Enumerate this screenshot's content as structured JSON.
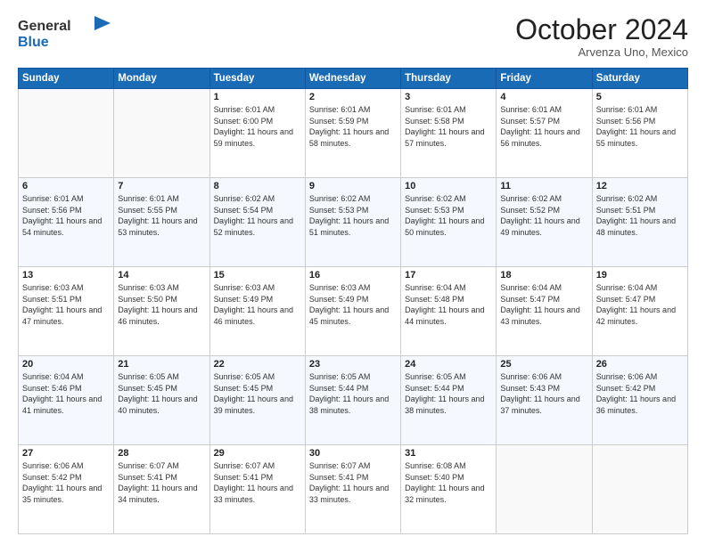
{
  "header": {
    "logo_line1": "General",
    "logo_line2": "Blue",
    "month": "October 2024",
    "location": "Arvenza Uno, Mexico"
  },
  "days_of_week": [
    "Sunday",
    "Monday",
    "Tuesday",
    "Wednesday",
    "Thursday",
    "Friday",
    "Saturday"
  ],
  "weeks": [
    [
      {
        "day": "",
        "info": ""
      },
      {
        "day": "",
        "info": ""
      },
      {
        "day": "1",
        "sunrise": "6:01 AM",
        "sunset": "6:00 PM",
        "daylight": "11 hours and 59 minutes."
      },
      {
        "day": "2",
        "sunrise": "6:01 AM",
        "sunset": "5:59 PM",
        "daylight": "11 hours and 58 minutes."
      },
      {
        "day": "3",
        "sunrise": "6:01 AM",
        "sunset": "5:58 PM",
        "daylight": "11 hours and 57 minutes."
      },
      {
        "day": "4",
        "sunrise": "6:01 AM",
        "sunset": "5:57 PM",
        "daylight": "11 hours and 56 minutes."
      },
      {
        "day": "5",
        "sunrise": "6:01 AM",
        "sunset": "5:56 PM",
        "daylight": "11 hours and 55 minutes."
      }
    ],
    [
      {
        "day": "6",
        "sunrise": "6:01 AM",
        "sunset": "5:56 PM",
        "daylight": "11 hours and 54 minutes."
      },
      {
        "day": "7",
        "sunrise": "6:01 AM",
        "sunset": "5:55 PM",
        "daylight": "11 hours and 53 minutes."
      },
      {
        "day": "8",
        "sunrise": "6:02 AM",
        "sunset": "5:54 PM",
        "daylight": "11 hours and 52 minutes."
      },
      {
        "day": "9",
        "sunrise": "6:02 AM",
        "sunset": "5:53 PM",
        "daylight": "11 hours and 51 minutes."
      },
      {
        "day": "10",
        "sunrise": "6:02 AM",
        "sunset": "5:53 PM",
        "daylight": "11 hours and 50 minutes."
      },
      {
        "day": "11",
        "sunrise": "6:02 AM",
        "sunset": "5:52 PM",
        "daylight": "11 hours and 49 minutes."
      },
      {
        "day": "12",
        "sunrise": "6:02 AM",
        "sunset": "5:51 PM",
        "daylight": "11 hours and 48 minutes."
      }
    ],
    [
      {
        "day": "13",
        "sunrise": "6:03 AM",
        "sunset": "5:51 PM",
        "daylight": "11 hours and 47 minutes."
      },
      {
        "day": "14",
        "sunrise": "6:03 AM",
        "sunset": "5:50 PM",
        "daylight": "11 hours and 46 minutes."
      },
      {
        "day": "15",
        "sunrise": "6:03 AM",
        "sunset": "5:49 PM",
        "daylight": "11 hours and 46 minutes."
      },
      {
        "day": "16",
        "sunrise": "6:03 AM",
        "sunset": "5:49 PM",
        "daylight": "11 hours and 45 minutes."
      },
      {
        "day": "17",
        "sunrise": "6:04 AM",
        "sunset": "5:48 PM",
        "daylight": "11 hours and 44 minutes."
      },
      {
        "day": "18",
        "sunrise": "6:04 AM",
        "sunset": "5:47 PM",
        "daylight": "11 hours and 43 minutes."
      },
      {
        "day": "19",
        "sunrise": "6:04 AM",
        "sunset": "5:47 PM",
        "daylight": "11 hours and 42 minutes."
      }
    ],
    [
      {
        "day": "20",
        "sunrise": "6:04 AM",
        "sunset": "5:46 PM",
        "daylight": "11 hours and 41 minutes."
      },
      {
        "day": "21",
        "sunrise": "6:05 AM",
        "sunset": "5:45 PM",
        "daylight": "11 hours and 40 minutes."
      },
      {
        "day": "22",
        "sunrise": "6:05 AM",
        "sunset": "5:45 PM",
        "daylight": "11 hours and 39 minutes."
      },
      {
        "day": "23",
        "sunrise": "6:05 AM",
        "sunset": "5:44 PM",
        "daylight": "11 hours and 38 minutes."
      },
      {
        "day": "24",
        "sunrise": "6:05 AM",
        "sunset": "5:44 PM",
        "daylight": "11 hours and 38 minutes."
      },
      {
        "day": "25",
        "sunrise": "6:06 AM",
        "sunset": "5:43 PM",
        "daylight": "11 hours and 37 minutes."
      },
      {
        "day": "26",
        "sunrise": "6:06 AM",
        "sunset": "5:42 PM",
        "daylight": "11 hours and 36 minutes."
      }
    ],
    [
      {
        "day": "27",
        "sunrise": "6:06 AM",
        "sunset": "5:42 PM",
        "daylight": "11 hours and 35 minutes."
      },
      {
        "day": "28",
        "sunrise": "6:07 AM",
        "sunset": "5:41 PM",
        "daylight": "11 hours and 34 minutes."
      },
      {
        "day": "29",
        "sunrise": "6:07 AM",
        "sunset": "5:41 PM",
        "daylight": "11 hours and 33 minutes."
      },
      {
        "day": "30",
        "sunrise": "6:07 AM",
        "sunset": "5:41 PM",
        "daylight": "11 hours and 33 minutes."
      },
      {
        "day": "31",
        "sunrise": "6:08 AM",
        "sunset": "5:40 PM",
        "daylight": "11 hours and 32 minutes."
      },
      {
        "day": "",
        "info": ""
      },
      {
        "day": "",
        "info": ""
      }
    ]
  ]
}
